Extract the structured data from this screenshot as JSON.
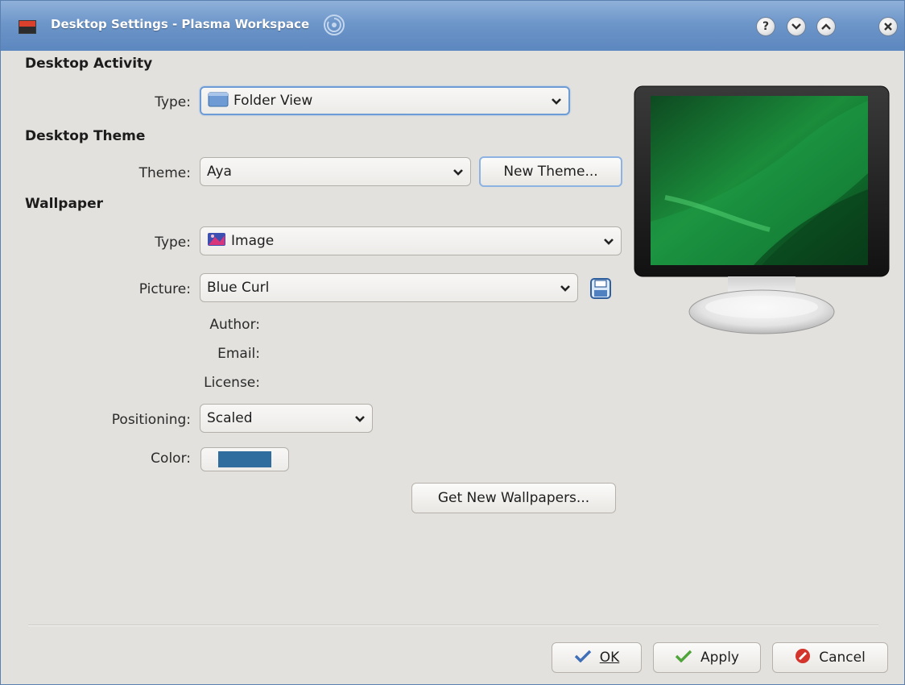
{
  "window": {
    "title": "Desktop Settings - Plasma Workspace",
    "titlebar_buttons": {
      "help": "?"
    }
  },
  "desktop_activity": {
    "heading": "Desktop Activity",
    "type_label": "Type:",
    "type_value": "Folder View"
  },
  "desktop_theme": {
    "heading": "Desktop Theme",
    "theme_label": "Theme:",
    "theme_value": "Aya",
    "new_theme_button": "New Theme..."
  },
  "wallpaper": {
    "heading": "Wallpaper",
    "type_label": "Type:",
    "type_value": "Image",
    "picture_label": "Picture:",
    "picture_value": "Blue Curl",
    "author_label": "Author:",
    "email_label": "Email:",
    "license_label": "License:",
    "positioning_label": "Positioning:",
    "positioning_value": "Scaled",
    "color_label": "Color:",
    "color_value": "#2f6d9f",
    "get_new_button": "Get New Wallpapers..."
  },
  "footer": {
    "ok_button": "OK",
    "apply_button": "Apply",
    "cancel_button": "Cancel"
  },
  "icons": [
    "window-app-icon",
    "swirl-icon",
    "help-icon",
    "minimize-icon",
    "maximize-icon",
    "close-icon",
    "folder-view-icon",
    "image-icon",
    "save-icon",
    "checkmark-icon",
    "cancel-icon",
    "chevron-down-icon"
  ],
  "colors": {
    "titlebar": "#6d96c9",
    "window_bg": "#e3e1dd",
    "focus_ring": "#6d9bd6"
  }
}
